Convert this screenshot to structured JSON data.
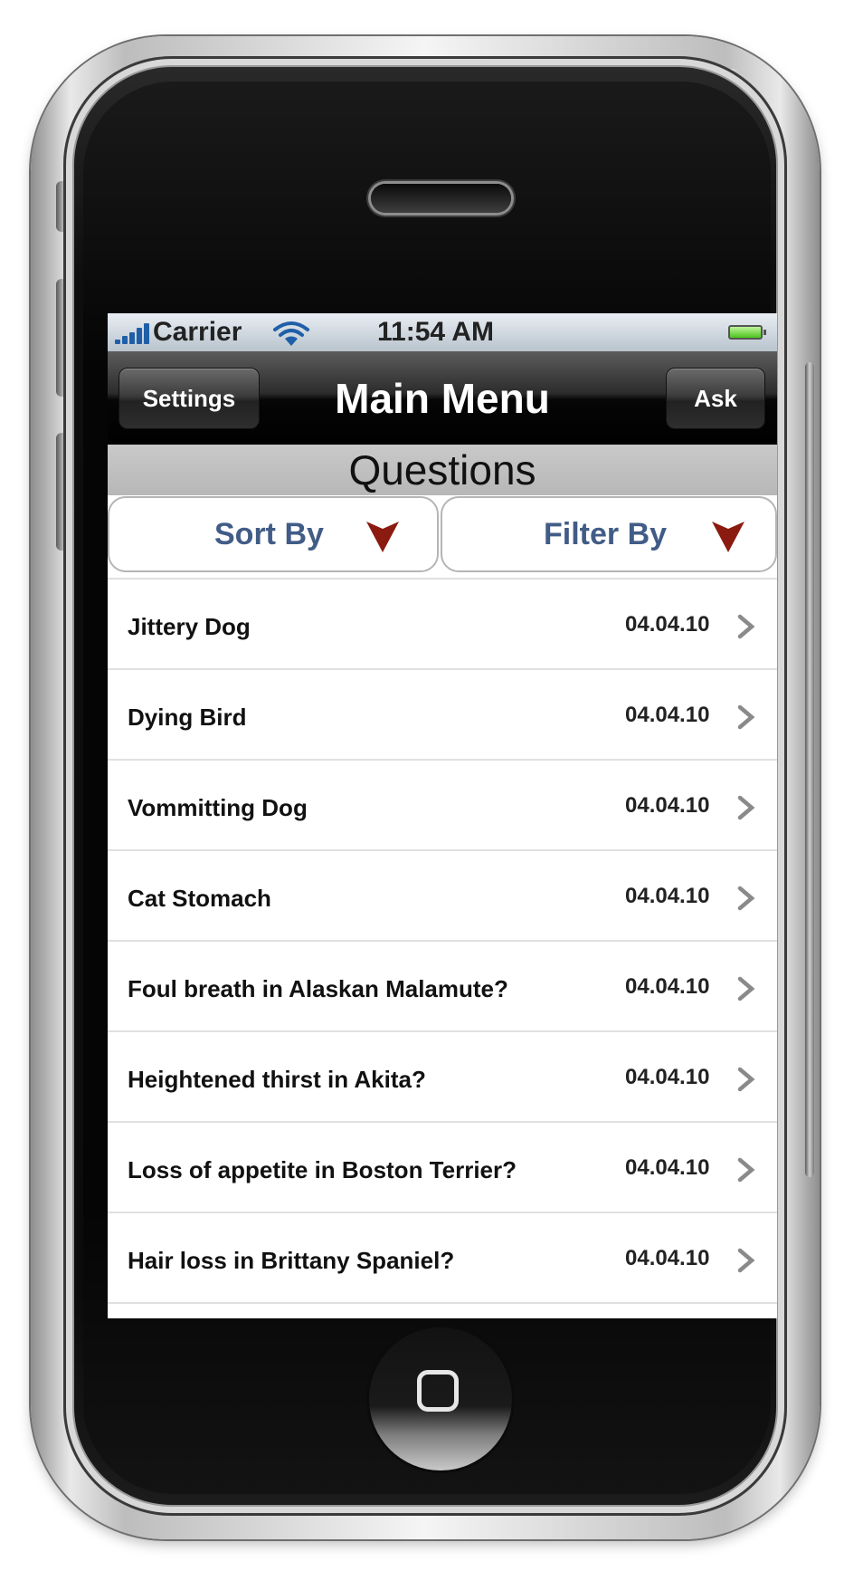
{
  "status_bar": {
    "carrier": "Carrier",
    "time": "11:54 AM"
  },
  "nav_bar": {
    "left_button": "Settings",
    "title": "Main Menu",
    "right_button": "Ask"
  },
  "section": {
    "title": "Questions"
  },
  "segments": {
    "sort_label": "Sort By",
    "filter_label": "Filter By"
  },
  "questions": [
    {
      "title": "Jittery Dog",
      "date": "04.04.10"
    },
    {
      "title": "Dying Bird",
      "date": "04.04.10"
    },
    {
      "title": "Vommitting Dog",
      "date": "04.04.10"
    },
    {
      "title": "Cat Stomach",
      "date": "04.04.10"
    },
    {
      "title": "Foul breath in Alaskan Malamute?",
      "date": "04.04.10"
    },
    {
      "title": "Heightened thirst in Akita?",
      "date": "04.04.10"
    },
    {
      "title": "Loss of appetite in Boston Terrier?",
      "date": "04.04.10"
    },
    {
      "title": "Hair loss in Brittany Spaniel?",
      "date": "04.04.10"
    }
  ],
  "icons": {
    "signal": "signal-bars-icon",
    "wifi": "wifi-icon",
    "battery": "battery-icon",
    "dropdown": "dropdown-arrow-icon",
    "chevron": "chevron-right-icon",
    "home": "home-button-icon"
  },
  "colors": {
    "segment_text": "#415c86",
    "dropdown_arrow": "#8b1a10",
    "battery_fill": "#4cc41d",
    "signal": "#1f5fa8"
  }
}
